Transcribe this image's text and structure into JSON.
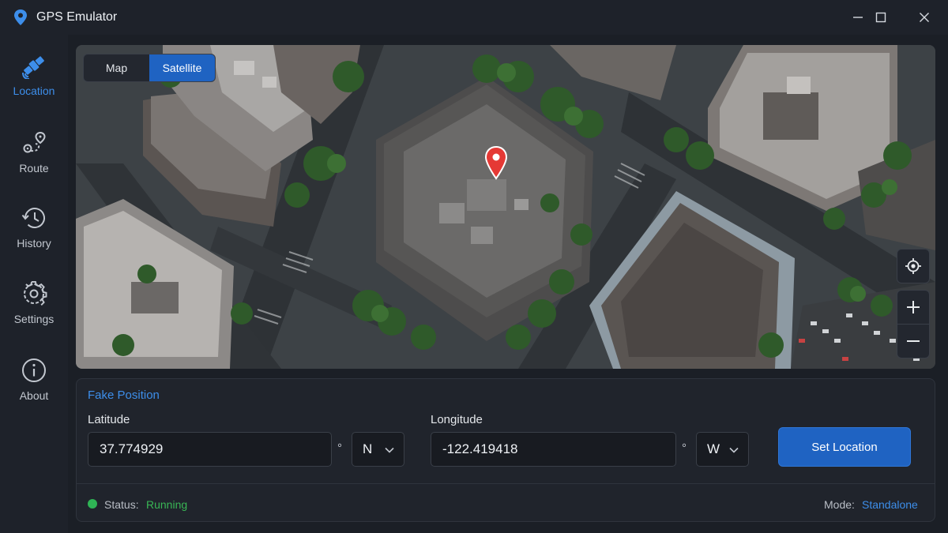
{
  "window": {
    "title": "GPS Emulator",
    "accent": "#1f63c2",
    "buttons": [
      "minimize",
      "maximize",
      "close"
    ]
  },
  "sidebar": {
    "items": [
      {
        "label": "Location",
        "icon": "satellite-icon",
        "active": true
      },
      {
        "label": "Route",
        "icon": "route-icon",
        "active": false
      },
      {
        "label": "History",
        "icon": "history-icon",
        "active": false
      },
      {
        "label": "Settings",
        "icon": "gear-icon",
        "active": false
      },
      {
        "label": "About",
        "icon": "info-icon",
        "active": false
      }
    ]
  },
  "map": {
    "view_toggle": {
      "options": [
        "Map",
        "Satellite"
      ],
      "selected": "Satellite"
    },
    "pin_color": "#e53935",
    "controls": [
      "locate-icon",
      "zoom-in-icon",
      "zoom-out-icon"
    ]
  },
  "position": {
    "title": "Fake Position",
    "latitude_label": "Latitude",
    "latitude_value": "37.774929",
    "latitude_unit": "°",
    "latitude_hemisphere": "N",
    "longitude_label": "Longitude",
    "longitude_value": "-122.419418",
    "longitude_unit": "°",
    "longitude_hemisphere": "W",
    "set_button": "Set Location"
  },
  "status": {
    "label": "Status:",
    "value": "Running",
    "color": "#39b655",
    "mode_label": "Mode:",
    "mode_value": "Standalone"
  }
}
